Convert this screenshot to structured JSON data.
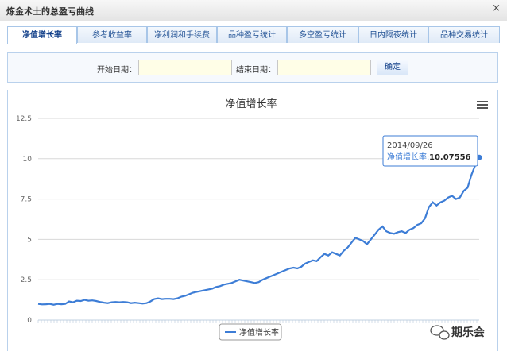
{
  "window": {
    "title": "炼金术士的总盈亏曲线",
    "close_glyph": "×"
  },
  "tabs": [
    {
      "label": "净值增长率",
      "active": true
    },
    {
      "label": "参考收益率",
      "active": false
    },
    {
      "label": "净利润和手续费",
      "active": false
    },
    {
      "label": "品种盈亏统计",
      "active": false
    },
    {
      "label": "多空盈亏统计",
      "active": false
    },
    {
      "label": "日内隔夜统计",
      "active": false
    },
    {
      "label": "品种交易统计",
      "active": false
    }
  ],
  "filter": {
    "start_label": "开始日期：",
    "end_label": "结束日期：",
    "start_value": "",
    "end_value": "",
    "confirm_label": "确定"
  },
  "chart_data": {
    "type": "line",
    "title": "净值增长率",
    "ylim": [
      0,
      12.5
    ],
    "yticks": [
      "0",
      "2.5",
      "5",
      "7.5",
      "10",
      "12.5"
    ],
    "grid": true,
    "legend": "bottom-center",
    "series": [
      {
        "name": "净值增长率",
        "color": "#3d7dd6",
        "values": [
          1.0,
          0.97,
          0.98,
          1.0,
          0.95,
          1.0,
          0.98,
          1.0,
          1.15,
          1.1,
          1.2,
          1.18,
          1.25,
          1.2,
          1.22,
          1.18,
          1.12,
          1.08,
          1.05,
          1.1,
          1.12,
          1.1,
          1.12,
          1.1,
          1.05,
          1.08,
          1.05,
          1.02,
          1.05,
          1.15,
          1.3,
          1.35,
          1.3,
          1.32,
          1.32,
          1.3,
          1.35,
          1.45,
          1.5,
          1.6,
          1.7,
          1.75,
          1.8,
          1.85,
          1.9,
          1.95,
          2.05,
          2.1,
          2.2,
          2.25,
          2.3,
          2.4,
          2.5,
          2.45,
          2.4,
          2.35,
          2.3,
          2.35,
          2.5,
          2.6,
          2.7,
          2.8,
          2.9,
          3.0,
          3.1,
          3.2,
          3.25,
          3.2,
          3.3,
          3.5,
          3.6,
          3.7,
          3.65,
          3.9,
          4.1,
          4.0,
          4.2,
          4.1,
          4.0,
          4.3,
          4.5,
          4.8,
          5.1,
          5.0,
          4.9,
          4.7,
          5.0,
          5.3,
          5.6,
          5.8,
          5.5,
          5.4,
          5.35,
          5.45,
          5.5,
          5.4,
          5.6,
          5.7,
          5.9,
          6.0,
          6.3,
          7.0,
          7.3,
          7.1,
          7.3,
          7.4,
          7.6,
          7.7,
          7.5,
          7.6,
          8.0,
          8.2,
          9.0,
          9.6,
          10.07556
        ]
      }
    ],
    "tooltip": {
      "date": "2014/09/26",
      "label": "净值增长率:",
      "value": "10.07556"
    }
  },
  "menu_icon": "hamburger-menu-icon",
  "watermark": {
    "text": "期乐会",
    "icon": "wechat-logo-icon"
  }
}
